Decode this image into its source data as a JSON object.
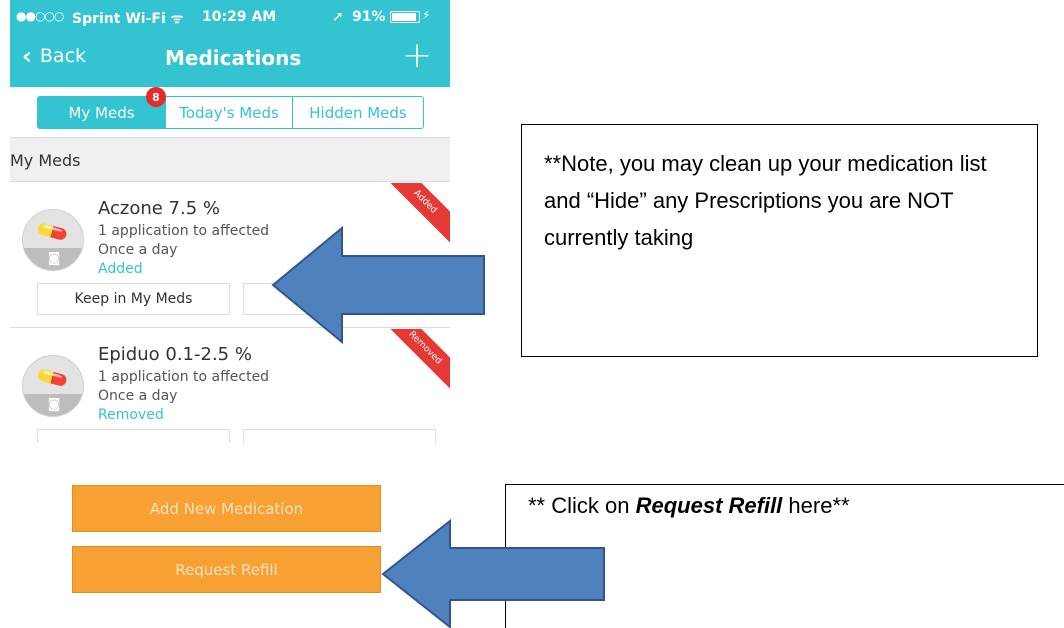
{
  "status_bar": {
    "signal": "●●○○○",
    "carrier": "Sprint Wi-Fi ᯤ",
    "time": "10:29 AM",
    "location_icon": "➚",
    "battery_pct": "91%",
    "battery_level": 0.91,
    "charging_icon": "⚡"
  },
  "nav": {
    "back_label": "Back",
    "back_icon": "chevron-left-icon",
    "title": "Medications",
    "add_icon": "plus-icon"
  },
  "tabs": [
    {
      "label": "My Meds",
      "active": true
    },
    {
      "label": "Today's Meds",
      "active": false
    },
    {
      "label": "Hidden Meds",
      "active": false
    }
  ],
  "tab_badge": "8",
  "section_header": "My Meds",
  "medications": [
    {
      "name": "Aczone 7.5 %",
      "dose": "1 application to affected",
      "frequency": "Once a day",
      "status": "Added",
      "corner_label": "Added",
      "button_keep": "Keep in My Meds",
      "button_hide": ""
    },
    {
      "name": "Epiduo 0.1-2.5 %",
      "dose": "1 application to affected",
      "frequency": "Once a day",
      "status": "Removed",
      "corner_label": "Removed",
      "button_keep": "",
      "button_hide": ""
    }
  ],
  "actions": {
    "add_new_medication": "Add New Medication",
    "request_refill": "Request Refill"
  },
  "notes": {
    "note1": "**Note, you may clean up your medication list and “Hide” any Prescriptions you are NOT currently taking",
    "note2_prefix": "** Click on ",
    "note2_emphasis": "Request Refill",
    "note2_suffix": " here**"
  },
  "colors": {
    "accent": "#34c3d1",
    "orange": "#f7a135",
    "arrow_blue": "#4f81bd",
    "badge_red": "#e62b2b"
  }
}
